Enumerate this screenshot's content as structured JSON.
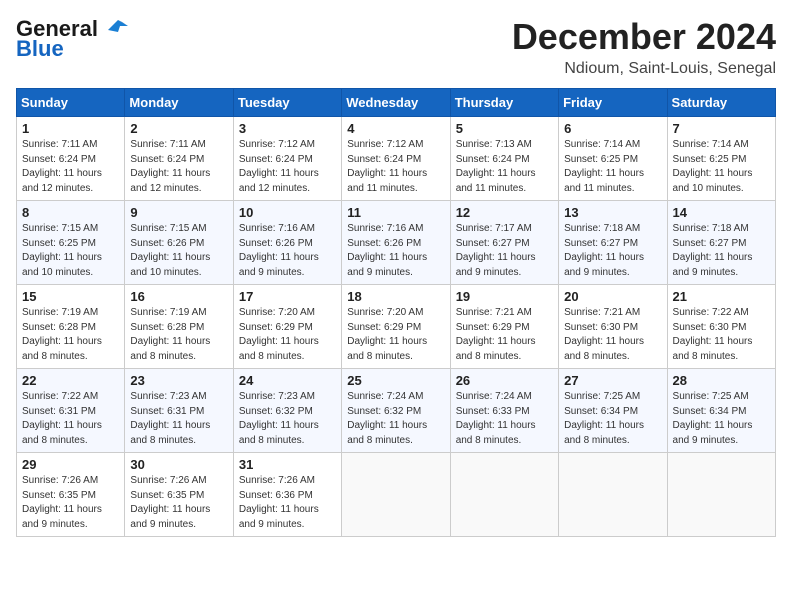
{
  "header": {
    "logo_line1": "General",
    "logo_line2": "Blue",
    "month_title": "December 2024",
    "location": "Ndioum, Saint-Louis, Senegal"
  },
  "weekdays": [
    "Sunday",
    "Monday",
    "Tuesday",
    "Wednesday",
    "Thursday",
    "Friday",
    "Saturday"
  ],
  "weeks": [
    [
      {
        "day": "1",
        "info": "Sunrise: 7:11 AM\nSunset: 6:24 PM\nDaylight: 11 hours\nand 12 minutes."
      },
      {
        "day": "2",
        "info": "Sunrise: 7:11 AM\nSunset: 6:24 PM\nDaylight: 11 hours\nand 12 minutes."
      },
      {
        "day": "3",
        "info": "Sunrise: 7:12 AM\nSunset: 6:24 PM\nDaylight: 11 hours\nand 12 minutes."
      },
      {
        "day": "4",
        "info": "Sunrise: 7:12 AM\nSunset: 6:24 PM\nDaylight: 11 hours\nand 11 minutes."
      },
      {
        "day": "5",
        "info": "Sunrise: 7:13 AM\nSunset: 6:24 PM\nDaylight: 11 hours\nand 11 minutes."
      },
      {
        "day": "6",
        "info": "Sunrise: 7:14 AM\nSunset: 6:25 PM\nDaylight: 11 hours\nand 11 minutes."
      },
      {
        "day": "7",
        "info": "Sunrise: 7:14 AM\nSunset: 6:25 PM\nDaylight: 11 hours\nand 10 minutes."
      }
    ],
    [
      {
        "day": "8",
        "info": "Sunrise: 7:15 AM\nSunset: 6:25 PM\nDaylight: 11 hours\nand 10 minutes."
      },
      {
        "day": "9",
        "info": "Sunrise: 7:15 AM\nSunset: 6:26 PM\nDaylight: 11 hours\nand 10 minutes."
      },
      {
        "day": "10",
        "info": "Sunrise: 7:16 AM\nSunset: 6:26 PM\nDaylight: 11 hours\nand 9 minutes."
      },
      {
        "day": "11",
        "info": "Sunrise: 7:16 AM\nSunset: 6:26 PM\nDaylight: 11 hours\nand 9 minutes."
      },
      {
        "day": "12",
        "info": "Sunrise: 7:17 AM\nSunset: 6:27 PM\nDaylight: 11 hours\nand 9 minutes."
      },
      {
        "day": "13",
        "info": "Sunrise: 7:18 AM\nSunset: 6:27 PM\nDaylight: 11 hours\nand 9 minutes."
      },
      {
        "day": "14",
        "info": "Sunrise: 7:18 AM\nSunset: 6:27 PM\nDaylight: 11 hours\nand 9 minutes."
      }
    ],
    [
      {
        "day": "15",
        "info": "Sunrise: 7:19 AM\nSunset: 6:28 PM\nDaylight: 11 hours\nand 8 minutes."
      },
      {
        "day": "16",
        "info": "Sunrise: 7:19 AM\nSunset: 6:28 PM\nDaylight: 11 hours\nand 8 minutes."
      },
      {
        "day": "17",
        "info": "Sunrise: 7:20 AM\nSunset: 6:29 PM\nDaylight: 11 hours\nand 8 minutes."
      },
      {
        "day": "18",
        "info": "Sunrise: 7:20 AM\nSunset: 6:29 PM\nDaylight: 11 hours\nand 8 minutes."
      },
      {
        "day": "19",
        "info": "Sunrise: 7:21 AM\nSunset: 6:29 PM\nDaylight: 11 hours\nand 8 minutes."
      },
      {
        "day": "20",
        "info": "Sunrise: 7:21 AM\nSunset: 6:30 PM\nDaylight: 11 hours\nand 8 minutes."
      },
      {
        "day": "21",
        "info": "Sunrise: 7:22 AM\nSunset: 6:30 PM\nDaylight: 11 hours\nand 8 minutes."
      }
    ],
    [
      {
        "day": "22",
        "info": "Sunrise: 7:22 AM\nSunset: 6:31 PM\nDaylight: 11 hours\nand 8 minutes."
      },
      {
        "day": "23",
        "info": "Sunrise: 7:23 AM\nSunset: 6:31 PM\nDaylight: 11 hours\nand 8 minutes."
      },
      {
        "day": "24",
        "info": "Sunrise: 7:23 AM\nSunset: 6:32 PM\nDaylight: 11 hours\nand 8 minutes."
      },
      {
        "day": "25",
        "info": "Sunrise: 7:24 AM\nSunset: 6:32 PM\nDaylight: 11 hours\nand 8 minutes."
      },
      {
        "day": "26",
        "info": "Sunrise: 7:24 AM\nSunset: 6:33 PM\nDaylight: 11 hours\nand 8 minutes."
      },
      {
        "day": "27",
        "info": "Sunrise: 7:25 AM\nSunset: 6:34 PM\nDaylight: 11 hours\nand 8 minutes."
      },
      {
        "day": "28",
        "info": "Sunrise: 7:25 AM\nSunset: 6:34 PM\nDaylight: 11 hours\nand 9 minutes."
      }
    ],
    [
      {
        "day": "29",
        "info": "Sunrise: 7:26 AM\nSunset: 6:35 PM\nDaylight: 11 hours\nand 9 minutes."
      },
      {
        "day": "30",
        "info": "Sunrise: 7:26 AM\nSunset: 6:35 PM\nDaylight: 11 hours\nand 9 minutes."
      },
      {
        "day": "31",
        "info": "Sunrise: 7:26 AM\nSunset: 6:36 PM\nDaylight: 11 hours\nand 9 minutes."
      },
      {
        "day": "",
        "info": ""
      },
      {
        "day": "",
        "info": ""
      },
      {
        "day": "",
        "info": ""
      },
      {
        "day": "",
        "info": ""
      }
    ]
  ]
}
